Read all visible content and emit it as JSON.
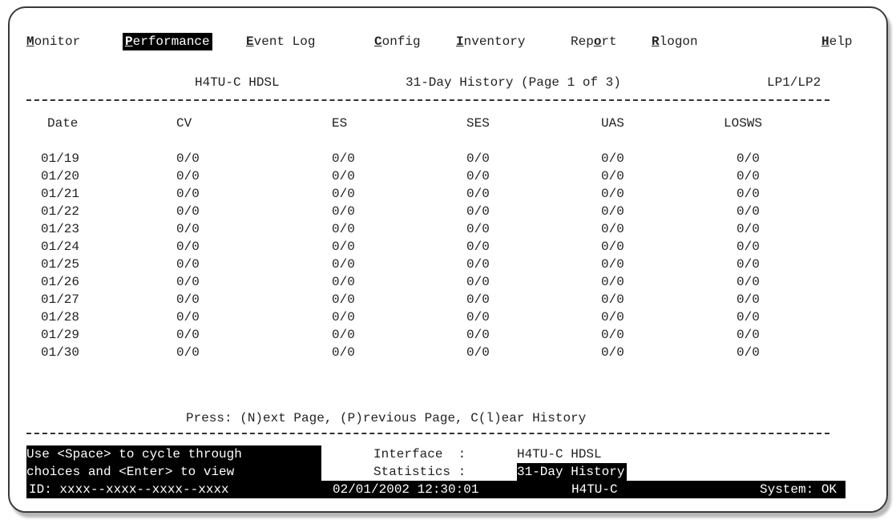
{
  "menu": [
    {
      "hotkey": "M",
      "rest": "onitor",
      "pre": ""
    },
    {
      "hotkey": "P",
      "rest": "erformance",
      "pre": ""
    },
    {
      "hotkey": "E",
      "rest": "vent Log",
      "pre": ""
    },
    {
      "hotkey": "C",
      "rest": "onfig",
      "pre": ""
    },
    {
      "hotkey": "I",
      "rest": "nventory",
      "pre": ""
    },
    {
      "pre": "Rep",
      "hotkey": "o",
      "rest": "rt"
    },
    {
      "hotkey": "R",
      "rest": "logon",
      "pre": ""
    },
    {
      "hotkey": "H",
      "rest": "elp",
      "pre": ""
    }
  ],
  "header": {
    "device": "H4TU-C HDSL",
    "title": "31-Day History (Page 1 of 3)",
    "loop": "LP1/LP2"
  },
  "table": {
    "columns": [
      "Date",
      "CV",
      "ES",
      "SES",
      "UAS",
      "LOSWS"
    ],
    "rows": [
      [
        "01/19",
        "0/0",
        "0/0",
        "0/0",
        "0/0",
        "0/0"
      ],
      [
        "01/20",
        "0/0",
        "0/0",
        "0/0",
        "0/0",
        "0/0"
      ],
      [
        "01/21",
        "0/0",
        "0/0",
        "0/0",
        "0/0",
        "0/0"
      ],
      [
        "01/22",
        "0/0",
        "0/0",
        "0/0",
        "0/0",
        "0/0"
      ],
      [
        "01/23",
        "0/0",
        "0/0",
        "0/0",
        "0/0",
        "0/0"
      ],
      [
        "01/24",
        "0/0",
        "0/0",
        "0/0",
        "0/0",
        "0/0"
      ],
      [
        "01/25",
        "0/0",
        "0/0",
        "0/0",
        "0/0",
        "0/0"
      ],
      [
        "01/26",
        "0/0",
        "0/0",
        "0/0",
        "0/0",
        "0/0"
      ],
      [
        "01/27",
        "0/0",
        "0/0",
        "0/0",
        "0/0",
        "0/0"
      ],
      [
        "01/28",
        "0/0",
        "0/0",
        "0/0",
        "0/0",
        "0/0"
      ],
      [
        "01/29",
        "0/0",
        "0/0",
        "0/0",
        "0/0",
        "0/0"
      ],
      [
        "01/30",
        "0/0",
        "0/0",
        "0/0",
        "0/0",
        "0/0"
      ]
    ]
  },
  "prompt": "Press: (N)ext Page, (P)revious Page, C(l)ear History",
  "help_text": {
    "line1": "Use <Space> to cycle through",
    "line2": "choices and <Enter> to view"
  },
  "fields": {
    "interface_label": "Interface  : ",
    "interface_value": "H4TU-C HDSL",
    "statistics_label": "Statistics : ",
    "statistics_value": "31-Day History"
  },
  "status": {
    "id": "ID: xxxx--xxxx--xxxx--xxxx",
    "datetime": "02/01/2002 12:30:01",
    "unit": "H4TU-C",
    "system": "System: OK"
  },
  "colors": {
    "background": "#ffffff",
    "text": "#222222",
    "inverse_bg": "#000000",
    "inverse_fg": "#ffffff"
  }
}
